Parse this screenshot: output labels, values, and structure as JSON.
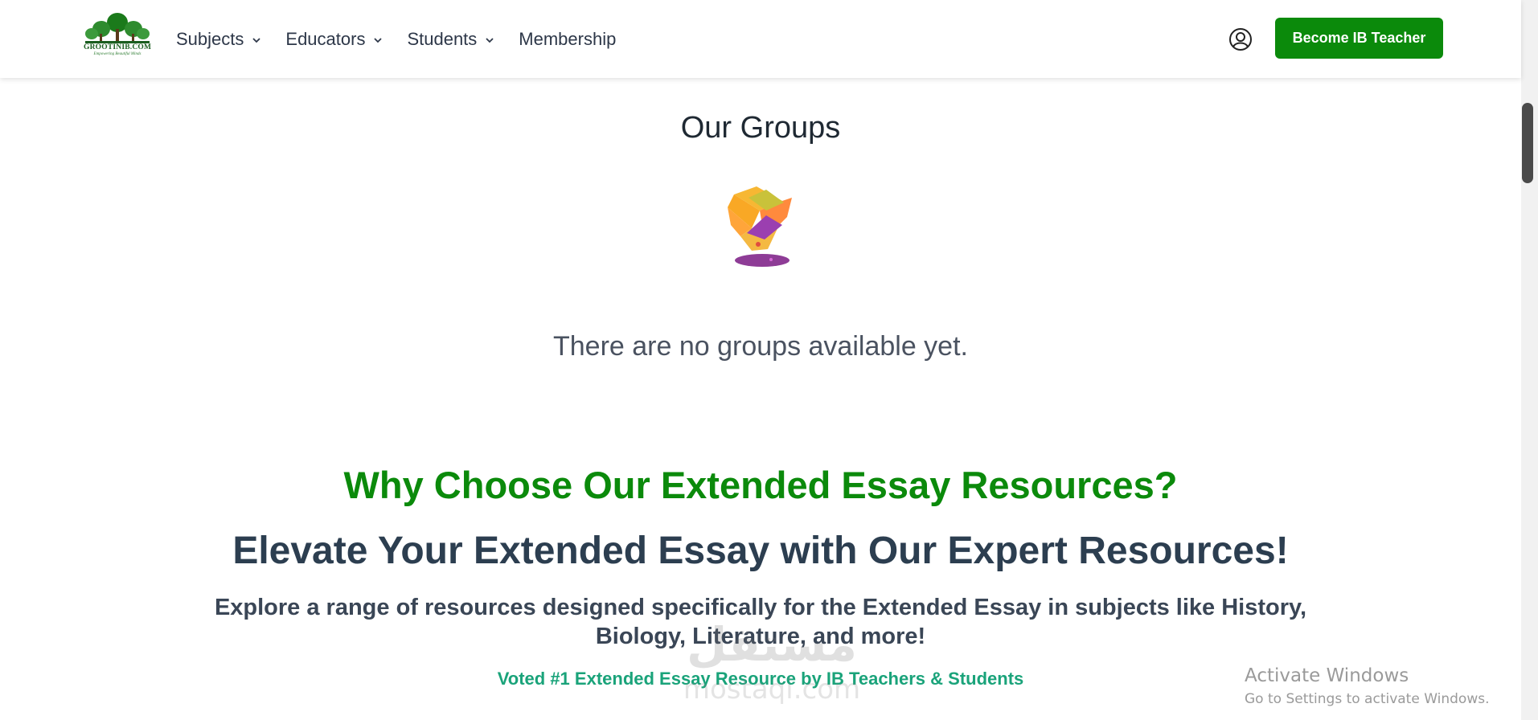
{
  "header": {
    "logo_text": "GROOTINIB.COM",
    "logo_tagline": "Empowering Beautiful Minds",
    "nav": [
      {
        "label": "Subjects",
        "has_dropdown": true
      },
      {
        "label": "Educators",
        "has_dropdown": true
      },
      {
        "label": "Students",
        "has_dropdown": true
      },
      {
        "label": "Membership",
        "has_dropdown": false
      }
    ],
    "cta_label": "Become IB Teacher",
    "icons": [
      "user-account-icon",
      "chevron-down-icon"
    ]
  },
  "groups": {
    "title": "Our Groups",
    "empty_message": "There are no groups available yet.",
    "illustration": "empty-box-icon"
  },
  "promo": {
    "headline": "Why Choose Our Extended Essay Resources?",
    "subheadline": "Elevate Your Extended Essay with Our Expert Resources!",
    "description": "Explore a range of resources designed specifically for the Extended Essay in subjects like History, Biology, Literature, and more!",
    "badge": "Voted #1 Extended Essay Resource by IB Teachers & Students"
  },
  "watermark": {
    "logo_text": "مستقل",
    "url": "mostaqi.com"
  },
  "os_overlay": {
    "title": "Activate Windows",
    "subtitle": "Go to Settings to activate Windows."
  },
  "colors": {
    "brand_green": "#0b8a0b",
    "accent_teal": "#1aa37a",
    "heading_dark": "#2c3e50"
  }
}
